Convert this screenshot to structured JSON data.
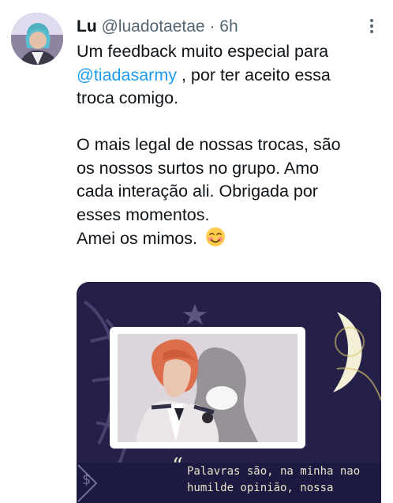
{
  "tweet": {
    "name": "Lu",
    "handle": "@luadotaetae",
    "separator": "·",
    "time": "6h",
    "lines": [
      "Um feedback muito especial para",
      "@tiadasarmy",
      " , por ter aceito essa",
      "troca comigo.",
      "O mais legal de nossas trocas, são",
      "os nossos surtos no grupo. Amo",
      "cada interação ali. Obrigada por",
      "esses momentos.",
      "Amei os mimos."
    ],
    "emoji_name": "smiling-face-with-smiling-eyes-and-blush-icon"
  },
  "media": {
    "quote_mark": "“",
    "quote_line_1": "Palavras são, na minha nao",
    "quote_line_2": "humilde opinião, nossa"
  },
  "colors": {
    "mention": "#1d9bf0",
    "secondary_text": "#536471",
    "photo_background": "#221f45",
    "moon": "#f4f0d7"
  }
}
